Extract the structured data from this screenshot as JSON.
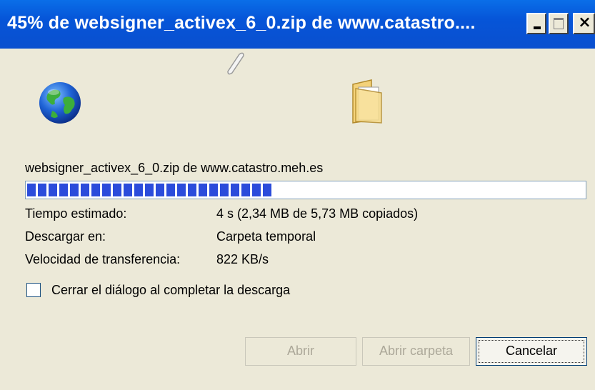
{
  "window": {
    "title": "45% de websigner_activex_6_0.zip de www.catastro....",
    "close_glyph": "×"
  },
  "download": {
    "file_and_source": "websigner_activex_6_0.zip de www.catastro.meh.es",
    "progress_fraction": 0.45,
    "eta_label": "Tiempo estimado:",
    "eta_value": "4 s (2,34 MB de 5,73 MB copiados)",
    "destination_label": "Descargar en:",
    "destination_value": "Carpeta temporal",
    "speed_label": "Velocidad de transferencia:",
    "speed_value": "822 KB/s"
  },
  "options": {
    "close_on_complete_label": "Cerrar el diálogo al completar la descarga",
    "close_on_complete_checked": false
  },
  "buttons": {
    "open_label": "Abrir",
    "open_folder_label": "Abrir carpeta",
    "cancel_label": "Cancelar"
  },
  "icons": {
    "source": "globe-icon",
    "destination": "folder-icon",
    "transfer_animation": "flying-paper-icon"
  },
  "colors": {
    "titlebar": "#0a55d8",
    "progress_blocks": "#2b4cdb",
    "window_face": "#ece9d8"
  }
}
